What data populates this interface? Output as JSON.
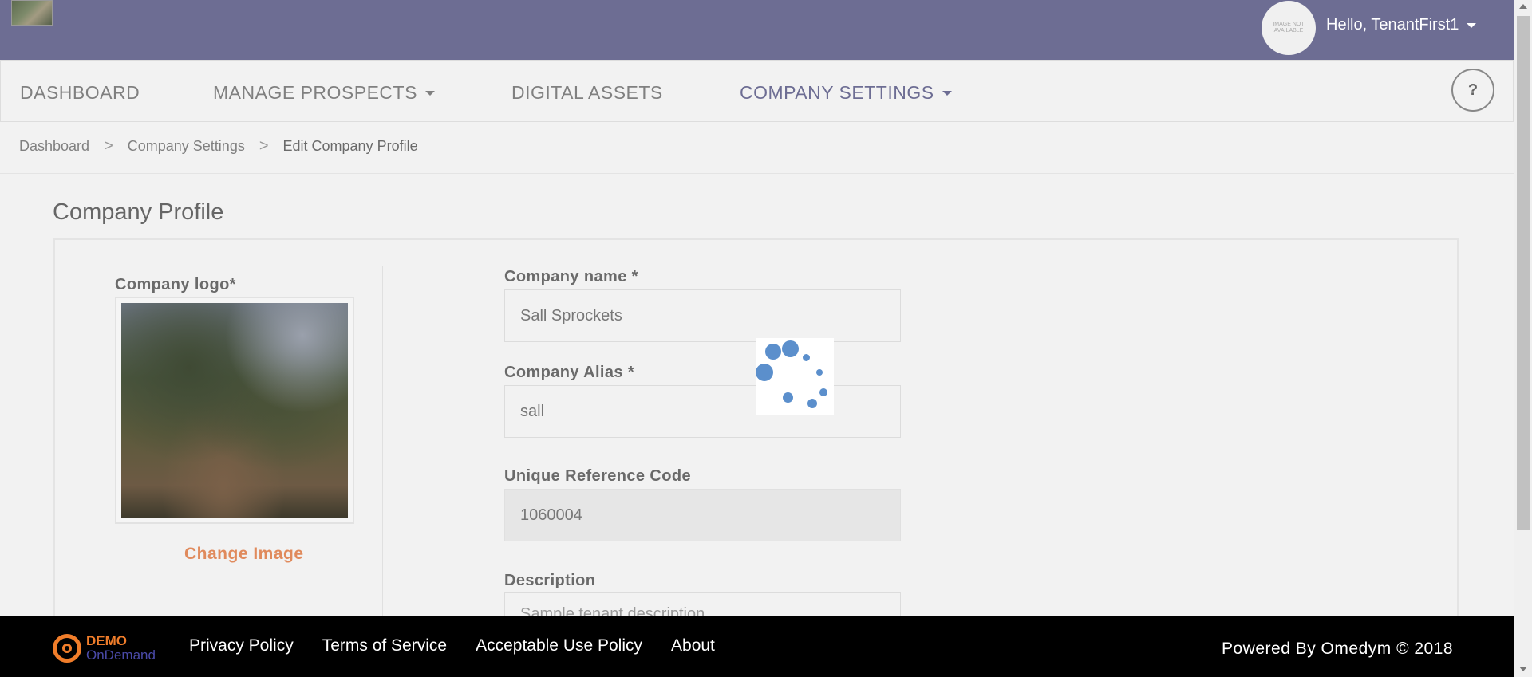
{
  "header": {
    "avatar_text": "IMAGE NOT AVAILABLE",
    "greeting": "Hello, TenantFirst1",
    "bar_color": "#6d6d93"
  },
  "nav": {
    "items": [
      {
        "label": "DASHBOARD",
        "dropdown": false,
        "active": false
      },
      {
        "label": "MANAGE PROSPECTS",
        "dropdown": true,
        "active": false
      },
      {
        "label": "DIGITAL ASSETS",
        "dropdown": false,
        "active": false
      },
      {
        "label": "COMPANY SETTINGS",
        "dropdown": true,
        "active": true
      }
    ],
    "help_label": "?"
  },
  "breadcrumb": {
    "items": [
      "Dashboard",
      "Company Settings",
      "Edit Company Profile"
    ],
    "separator": ">"
  },
  "page": {
    "title": "Company Profile",
    "logo_label": "Company logo*",
    "change_image_label": "Change Image",
    "fields": {
      "company_name": {
        "label": "Company name *",
        "value": "Sall Sprockets"
      },
      "company_alias": {
        "label": "Company Alias *",
        "value": "sall"
      },
      "reference_code": {
        "label": "Unique Reference Code",
        "value": "1060004",
        "disabled": true
      },
      "description": {
        "label": "Description",
        "value": "Sample tenant description"
      }
    },
    "loading": true
  },
  "footer": {
    "logo_top": "DEMO",
    "logo_bottom": "OnDemand",
    "links": [
      "Privacy Policy",
      "Terms of Service",
      "Acceptable Use Policy",
      "About"
    ],
    "powered_by": "Powered By Omedym © 2018",
    "accent_color": "#f07d2a"
  }
}
